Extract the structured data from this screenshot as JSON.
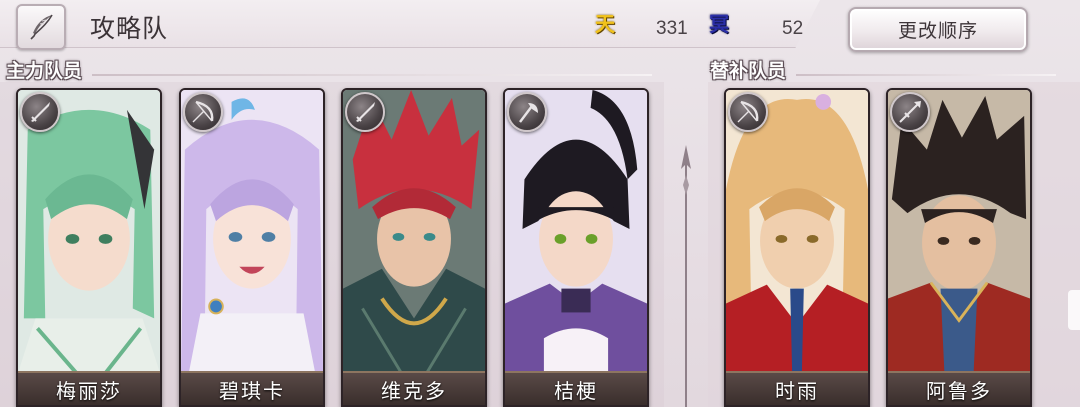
{
  "header": {
    "team_name": "攻略队",
    "stats": {
      "tian": {
        "icon_char": "天",
        "value": "331",
        "color": "#f1c21b"
      },
      "ming": {
        "icon_char": "冥",
        "value": "52",
        "color": "#2b2fa8"
      }
    },
    "change_order_label": "更改顺序"
  },
  "sections": {
    "main_label": "主力队员",
    "sub_label": "替补队员"
  },
  "main_team": [
    {
      "name": "梅丽莎",
      "weapon": "sword-icon",
      "hair": "#7cc7a0",
      "bg": "#dfe9e4",
      "outfit": "#e8efe9"
    },
    {
      "name": "碧琪卡",
      "weapon": "bow-icon",
      "hair": "#cdb8ea",
      "bg": "#ece4f4",
      "outfit": "#f3f0f7"
    },
    {
      "name": "维克多",
      "weapon": "sword-icon",
      "hair": "#c8303e",
      "bg": "#6b7a75",
      "outfit": "#2f4a4a"
    },
    {
      "name": "桔梗",
      "weapon": "axe-icon",
      "hair": "#1e1a22",
      "bg": "#e6dff0",
      "outfit": "#6f4f9e"
    }
  ],
  "reserve_team": [
    {
      "name": "时雨",
      "weapon": "bow-icon",
      "hair": "#e7b97b",
      "bg": "#f3e6d3",
      "outfit": "#b51f24"
    },
    {
      "name": "阿鲁多",
      "weapon": "spear-icon",
      "hair": "#2b2220",
      "bg": "#c6b9a7",
      "outfit": "#9e2a22"
    }
  ]
}
